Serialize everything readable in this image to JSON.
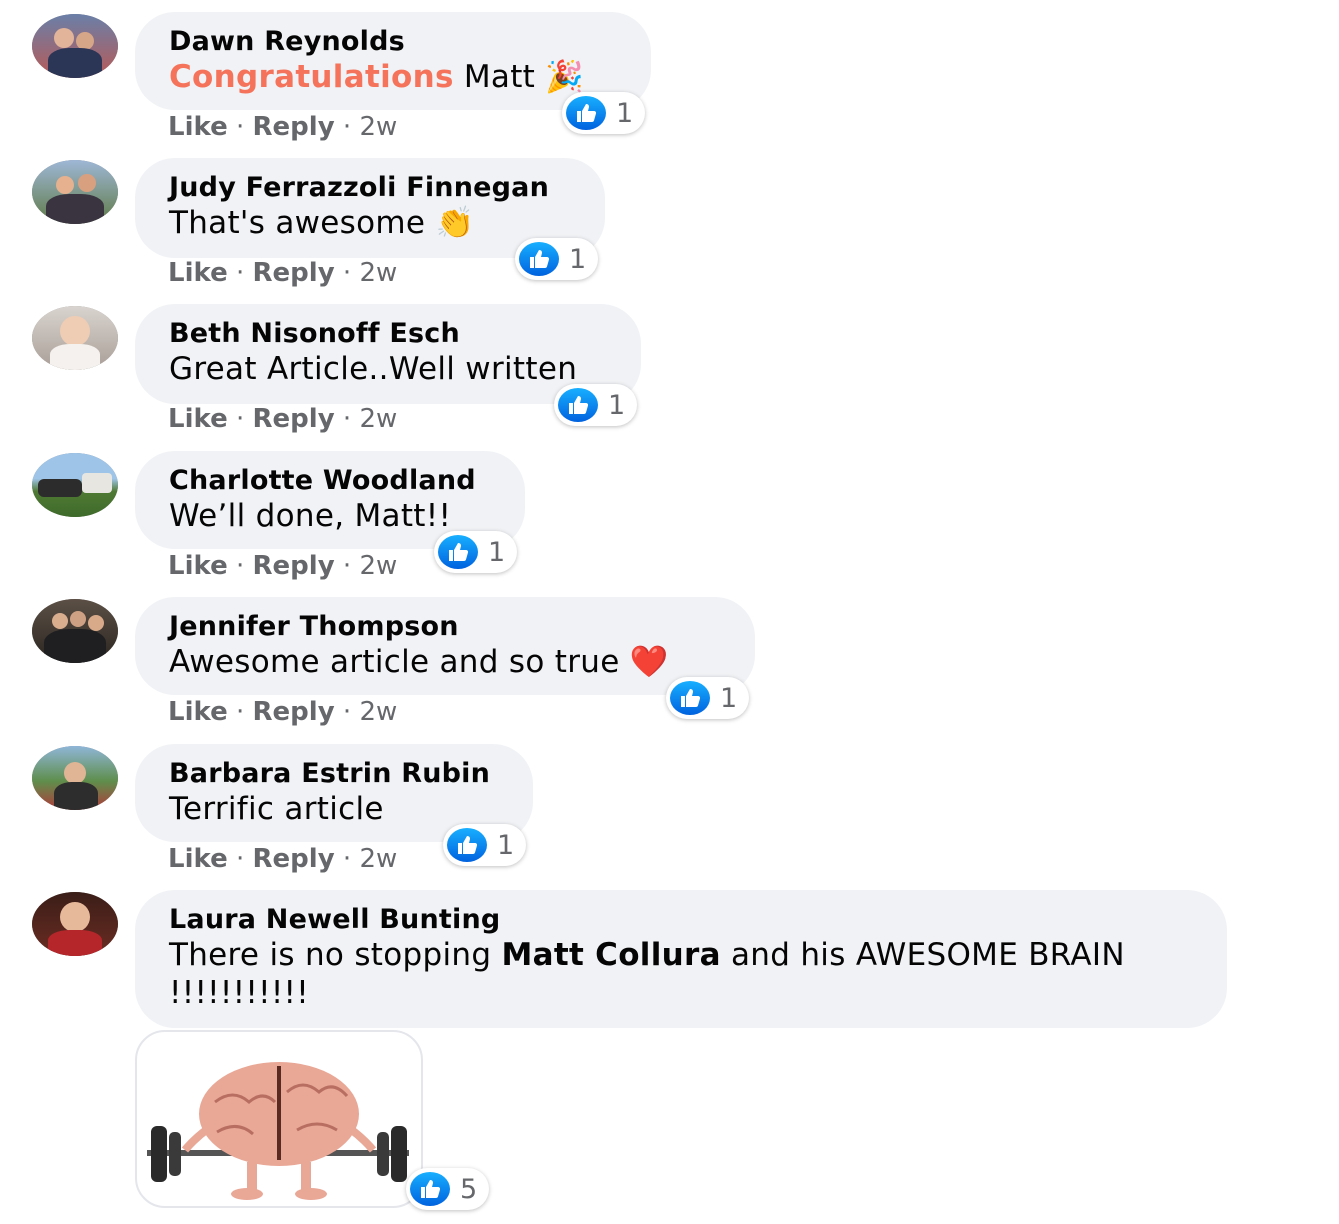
{
  "comments": [
    {
      "author": "Dawn Reynolds",
      "text_highlight": "Congratulations",
      "text": " Matt ",
      "emoji": "🎉",
      "actions": {
        "like": "Like",
        "reply": "Reply",
        "time": "2w"
      },
      "reactions": {
        "icon": "like-icon",
        "count": "1"
      }
    },
    {
      "author": "Judy Ferrazzoli Finnegan",
      "text": "That's awesome ",
      "emoji": "👏",
      "actions": {
        "like": "Like",
        "reply": "Reply",
        "time": "2w"
      },
      "reactions": {
        "icon": "like-icon",
        "count": "1"
      }
    },
    {
      "author": "Beth Nisonoff Esch",
      "text": "Great Article..Well written",
      "actions": {
        "like": "Like",
        "reply": "Reply",
        "time": "2w"
      },
      "reactions": {
        "icon": "like-icon",
        "count": "1"
      }
    },
    {
      "author": "Charlotte Woodland",
      "text": "We’ll done, Matt!!",
      "actions": {
        "like": "Like",
        "reply": "Reply",
        "time": "2w"
      },
      "reactions": {
        "icon": "like-icon",
        "count": "1"
      }
    },
    {
      "author": "Jennifer Thompson",
      "text": "Awesome article and so true ",
      "emoji": "❤️",
      "actions": {
        "like": "Like",
        "reply": "Reply",
        "time": "2w"
      },
      "reactions": {
        "icon": "like-icon",
        "count": "1"
      }
    },
    {
      "author": "Barbara Estrin Rubin",
      "text": "Terrific article",
      "actions": {
        "like": "Like",
        "reply": "Reply",
        "time": "2w"
      },
      "reactions": {
        "icon": "like-icon",
        "count": "1"
      }
    },
    {
      "author": "Laura Newell Bunting",
      "text_before": "There is no stopping ",
      "mention": "Matt Collura",
      "text_after": " and his AWESOME BRAIN !!!!!!!!!!!",
      "sticker": "brain-lifting-barbell-sticker",
      "reactions": {
        "icon": "like-icon",
        "count": "5"
      }
    }
  ],
  "separator": "·"
}
